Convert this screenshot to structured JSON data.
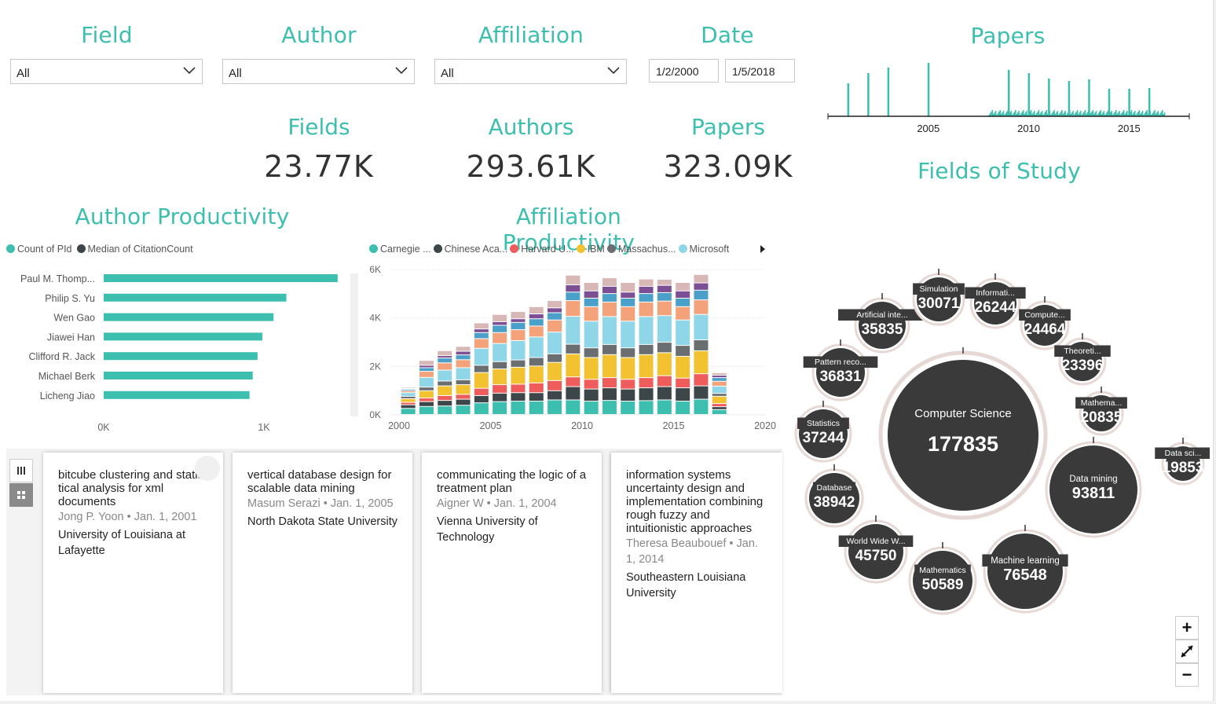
{
  "filters": {
    "field": {
      "label": "Field",
      "value": "All"
    },
    "author": {
      "label": "Author",
      "value": "All"
    },
    "affiliation": {
      "label": "Affiliation",
      "value": "All"
    },
    "date": {
      "label": "Date",
      "start": "1/2/2000",
      "end": "1/5/2018"
    }
  },
  "kpis": {
    "fields": {
      "label": "Fields",
      "value": "23.77K"
    },
    "authors": {
      "label": "Authors",
      "value": "293.61K"
    },
    "papers": {
      "label": "Papers",
      "value": "323.09K"
    }
  },
  "colors": {
    "accent": "#3cbfae",
    "dark": "#3d3d3d",
    "bubble": "#3a3a3a"
  },
  "icons": [
    "chevron-down-icon",
    "legend-next-icon",
    "table-view-icon",
    "grid-view-icon",
    "zoom-in-icon",
    "reset-zoom-icon",
    "zoom-out-icon"
  ],
  "papers_timeline": {
    "title": "Papers"
  },
  "author_productivity": {
    "title": "Author Productivity"
  },
  "affiliation_productivity": {
    "title": "Affiliation Productivity"
  },
  "fields_of_study": {
    "title": "Fields of Study"
  },
  "chart_data": [
    {
      "type": "bar",
      "id": "papers-timeline",
      "title": "Papers",
      "x_ticks": [
        "2005",
        "2010",
        "2015"
      ],
      "xlim": [
        2000,
        2018
      ],
      "spikes": [
        {
          "x": 2001.0,
          "value": 0.42
        },
        {
          "x": 2002.0,
          "value": 0.55
        },
        {
          "x": 2003.0,
          "value": 0.62
        },
        {
          "x": 2005.0,
          "value": 0.73
        },
        {
          "x": 2009.0,
          "value": 0.59
        },
        {
          "x": 2010.0,
          "value": 0.55
        },
        {
          "x": 2011.0,
          "value": 0.48
        },
        {
          "x": 2012.0,
          "value": 0.45
        },
        {
          "x": 2013.0,
          "value": 0.47
        },
        {
          "x": 2014.0,
          "value": 0.35
        },
        {
          "x": 2015.0,
          "value": 0.35
        },
        {
          "x": 2016.0,
          "value": 0.36
        }
      ],
      "baseline_noise": true
    },
    {
      "type": "bar",
      "id": "author-productivity",
      "orientation": "horizontal",
      "title": "Author Productivity",
      "legend": [
        "Count of PId",
        "Median of CitationCount"
      ],
      "legend_colors": [
        "#3cbfae",
        "#3d4648"
      ],
      "categories": [
        "Paul M. Thomp...",
        "Philip S. Yu",
        "Wen Gao",
        "Jiawei Han",
        "Clifford R. Jack",
        "Michael Berk",
        "Licheng Jiao"
      ],
      "values": [
        1460,
        1140,
        1060,
        990,
        960,
        930,
        910
      ],
      "x_ticks": [
        "0K",
        "1K"
      ],
      "xlim": [
        0,
        1500
      ]
    },
    {
      "type": "bar",
      "id": "affiliation-productivity",
      "stacked": true,
      "title": "Affiliation Productivity",
      "legend": [
        "Carnegie ...",
        "Chinese Aca...",
        "Harvard U...",
        "IBM",
        "Massachus...",
        "Microsoft"
      ],
      "y_ticks": [
        "0K",
        "2K",
        "4K",
        "6K"
      ],
      "ylim": [
        0,
        6000
      ],
      "x_ticks": [
        "2000",
        "2005",
        "2010",
        "2015",
        "2020"
      ],
      "xlim": [
        2000,
        2020
      ],
      "series_colors": [
        "#3cbfae",
        "#3d4648",
        "#ee5c5c",
        "#f2c230",
        "#6a6e70",
        "#8fd6e8",
        "#f4a27a",
        "#4aa0c8",
        "#7c4f94",
        "#d8b7b7"
      ],
      "years": [
        2000,
        2001,
        2002,
        2003,
        2004,
        2005,
        2006,
        2007,
        2008,
        2009,
        2010,
        2011,
        2012,
        2013,
        2014,
        2015,
        2016,
        2017
      ],
      "stacks": [
        [
          250,
          150,
          100,
          150,
          100,
          150,
          80,
          60,
          30,
          50
        ],
        [
          330,
          200,
          150,
          300,
          150,
          400,
          250,
          150,
          100,
          200
        ],
        [
          350,
          230,
          200,
          400,
          200,
          450,
          300,
          200,
          100,
          200
        ],
        [
          380,
          250,
          200,
          400,
          200,
          500,
          330,
          200,
          150,
          200
        ],
        [
          480,
          300,
          300,
          650,
          300,
          700,
          400,
          250,
          150,
          250
        ],
        [
          530,
          350,
          350,
          650,
          300,
          750,
          450,
          300,
          150,
          300
        ],
        [
          550,
          350,
          350,
          700,
          300,
          800,
          450,
          300,
          150,
          300
        ],
        [
          550,
          350,
          400,
          700,
          350,
          850,
          450,
          300,
          200,
          300
        ],
        [
          600,
          380,
          420,
          750,
          350,
          900,
          500,
          300,
          200,
          300
        ],
        [
          600,
          550,
          400,
          950,
          400,
          1150,
          650,
          350,
          300,
          400
        ],
        [
          550,
          500,
          400,
          900,
          400,
          1100,
          600,
          350,
          300,
          350
        ],
        [
          580,
          520,
          420,
          950,
          420,
          1150,
          600,
          350,
          300,
          350
        ],
        [
          550,
          500,
          400,
          900,
          400,
          1100,
          600,
          350,
          250,
          400
        ],
        [
          570,
          530,
          420,
          950,
          420,
          1150,
          600,
          350,
          300,
          300
        ],
        [
          600,
          550,
          450,
          950,
          430,
          1100,
          600,
          350,
          300,
          250
        ],
        [
          550,
          550,
          400,
          900,
          450,
          1050,
          550,
          350,
          300,
          350
        ],
        [
          630,
          550,
          500,
          950,
          450,
          1050,
          600,
          400,
          300,
          350
        ],
        [
          200,
          120,
          130,
          300,
          120,
          300,
          200,
          150,
          100,
          100
        ]
      ]
    },
    {
      "type": "bubble",
      "id": "fields-of-study",
      "title": "Fields of Study",
      "bubbles": [
        {
          "name": "Computer Science",
          "value": 177835
        },
        {
          "name": "Data mining",
          "value": 93811
        },
        {
          "name": "Machine learning",
          "value": 76548
        },
        {
          "name": "Mathematics",
          "value": 50589
        },
        {
          "name": "World Wide W...",
          "value": 45750
        },
        {
          "name": "Database",
          "value": 38942
        },
        {
          "name": "Statistics",
          "value": 37244
        },
        {
          "name": "Pattern reco...",
          "value": 36831
        },
        {
          "name": "Artificial inte...",
          "value": 35835
        },
        {
          "name": "Simulation",
          "value": 30071
        },
        {
          "name": "Informati...",
          "value": 26244
        },
        {
          "name": "Compute...",
          "value": 24464
        },
        {
          "name": "Theoreti...",
          "value": 23396
        },
        {
          "name": "Mathema...",
          "value": 20835
        },
        {
          "name": "Data sci...",
          "value": 19853
        }
      ]
    }
  ],
  "papers_list": [
    {
      "title": "bitcube clustering and statis tical analysis for xml documents",
      "author": "Jong P. Yoon",
      "date": "Jan. 1, 2001",
      "affiliation": "University of Louisiana at Lafayette"
    },
    {
      "title": "vertical database design for scalable data mining",
      "author": "Masum Serazi",
      "date": "Jan. 1, 2005",
      "affiliation": "North Dakota State University"
    },
    {
      "title": "communicating the logic of a treatment plan",
      "author": "Aigner W",
      "date": "Jan. 1, 2004",
      "affiliation": "Vienna University of Technology"
    },
    {
      "title": "information systems uncertainty design and implementation combining rough fuzzy and intuitionistic approaches",
      "author": "Theresa Beaubouef",
      "date": "Jan. 1, 2014",
      "affiliation": "Southeastern Louisiana University"
    }
  ],
  "zoom_controls": {
    "zoom_in": "+",
    "zoom_out": "−"
  }
}
